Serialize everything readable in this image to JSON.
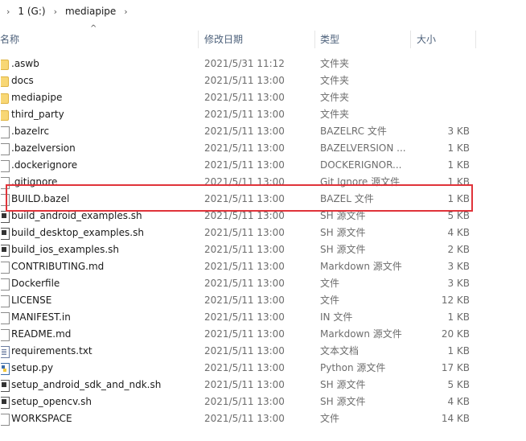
{
  "breadcrumb": [
    "1 (G:)",
    "mediapipe"
  ],
  "columns": {
    "name": "名称",
    "date": "修改日期",
    "type": "类型",
    "size": "大小"
  },
  "files": [
    {
      "name": ".aswb",
      "date": "2021/5/31 11:12",
      "type": "文件夹",
      "size": "",
      "icon": "folder-icon"
    },
    {
      "name": "docs",
      "date": "2021/5/11 13:00",
      "type": "文件夹",
      "size": "",
      "icon": "folder-icon"
    },
    {
      "name": "mediapipe",
      "date": "2021/5/11 13:00",
      "type": "文件夹",
      "size": "",
      "icon": "folder-icon"
    },
    {
      "name": "third_party",
      "date": "2021/5/11 13:00",
      "type": "文件夹",
      "size": "",
      "icon": "folder-icon"
    },
    {
      "name": ".bazelrc",
      "date": "2021/5/11 13:00",
      "type": "BAZELRC 文件",
      "size": "3 KB",
      "icon": "file-icon"
    },
    {
      "name": ".bazelversion",
      "date": "2021/5/11 13:00",
      "type": "BAZELVERSION ...",
      "size": "1 KB",
      "icon": "file-icon"
    },
    {
      "name": ".dockerignore",
      "date": "2021/5/11 13:00",
      "type": "DOCKERIGNOR...",
      "size": "1 KB",
      "icon": "file-icon"
    },
    {
      "name": ".gitignore",
      "date": "2021/5/11 13:00",
      "type": "Git Ignore 源文件",
      "size": "1 KB",
      "icon": "file-icon"
    },
    {
      "name": "BUILD.bazel",
      "date": "2021/5/11 13:00",
      "type": "BAZEL 文件",
      "size": "1 KB",
      "icon": "file-icon"
    },
    {
      "name": "build_android_examples.sh",
      "date": "2021/5/11 13:00",
      "type": "SH 源文件",
      "size": "5 KB",
      "icon": "script-icon"
    },
    {
      "name": "build_desktop_examples.sh",
      "date": "2021/5/11 13:00",
      "type": "SH 源文件",
      "size": "4 KB",
      "icon": "script-icon"
    },
    {
      "name": "build_ios_examples.sh",
      "date": "2021/5/11 13:00",
      "type": "SH 源文件",
      "size": "2 KB",
      "icon": "script-icon"
    },
    {
      "name": "CONTRIBUTING.md",
      "date": "2021/5/11 13:00",
      "type": "Markdown 源文件",
      "size": "3 KB",
      "icon": "file-icon"
    },
    {
      "name": "Dockerfile",
      "date": "2021/5/11 13:00",
      "type": "文件",
      "size": "3 KB",
      "icon": "file-icon"
    },
    {
      "name": "LICENSE",
      "date": "2021/5/11 13:00",
      "type": "文件",
      "size": "12 KB",
      "icon": "file-icon"
    },
    {
      "name": "MANIFEST.in",
      "date": "2021/5/11 13:00",
      "type": "IN 文件",
      "size": "1 KB",
      "icon": "file-icon"
    },
    {
      "name": "README.md",
      "date": "2021/5/11 13:00",
      "type": "Markdown 源文件",
      "size": "20 KB",
      "icon": "file-icon"
    },
    {
      "name": "requirements.txt",
      "date": "2021/5/11 13:00",
      "type": "文本文档",
      "size": "1 KB",
      "icon": "doc-icon"
    },
    {
      "name": "setup.py",
      "date": "2021/5/11 13:00",
      "type": "Python 源文件",
      "size": "17 KB",
      "icon": "python-icon"
    },
    {
      "name": "setup_android_sdk_and_ndk.sh",
      "date": "2021/5/11 13:00",
      "type": "SH 源文件",
      "size": "5 KB",
      "icon": "script-icon"
    },
    {
      "name": "setup_opencv.sh",
      "date": "2021/5/11 13:00",
      "type": "SH 源文件",
      "size": "4 KB",
      "icon": "script-icon"
    },
    {
      "name": "WORKSPACE",
      "date": "2021/5/11 13:00",
      "type": "文件",
      "size": "14 KB",
      "icon": "file-icon"
    }
  ],
  "highlight_color": "#e0333a",
  "folder_color": "#f8d775"
}
